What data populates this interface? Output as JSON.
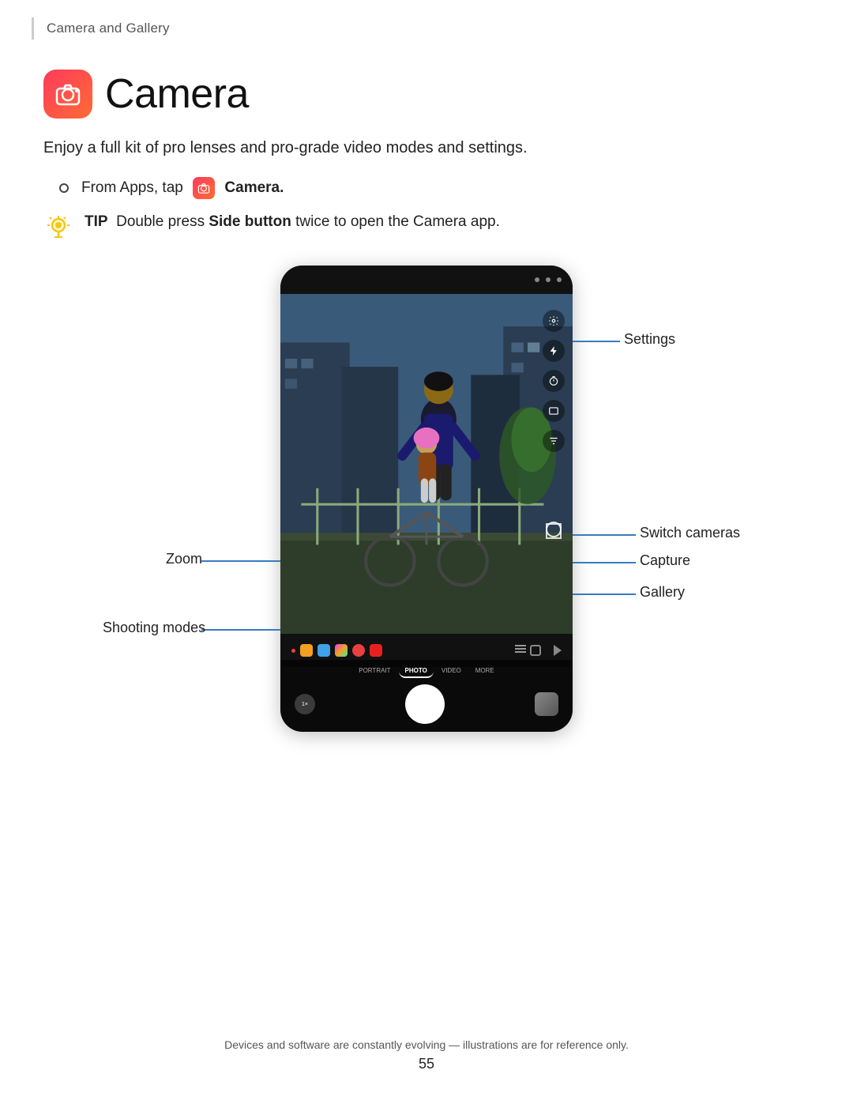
{
  "header": {
    "breadcrumb": "Camera and Gallery"
  },
  "page": {
    "title": "Camera",
    "description": "Enjoy a full kit of pro lenses and pro-grade video modes and settings.",
    "bullet": {
      "text_before": "From Apps, tap",
      "app_name": "Camera.",
      "app_name_bold": true
    },
    "tip": {
      "label": "TIP",
      "text_before": "Double press",
      "bold_text": "Side button",
      "text_after": "twice to open the Camera app."
    }
  },
  "diagram": {
    "annotations": {
      "settings": "Settings",
      "switch_cameras": "Switch cameras",
      "capture": "Capture",
      "gallery": "Gallery",
      "zoom": "Zoom",
      "shooting_modes": "Shooting modes"
    },
    "camera_modes": [
      "PORTRAIT",
      "PHOTO",
      "VIDEO",
      "MORE"
    ],
    "active_mode": "PHOTO"
  },
  "footer": {
    "note": "Devices and software are constantly evolving — illustrations are for reference only.",
    "page_number": "55"
  }
}
